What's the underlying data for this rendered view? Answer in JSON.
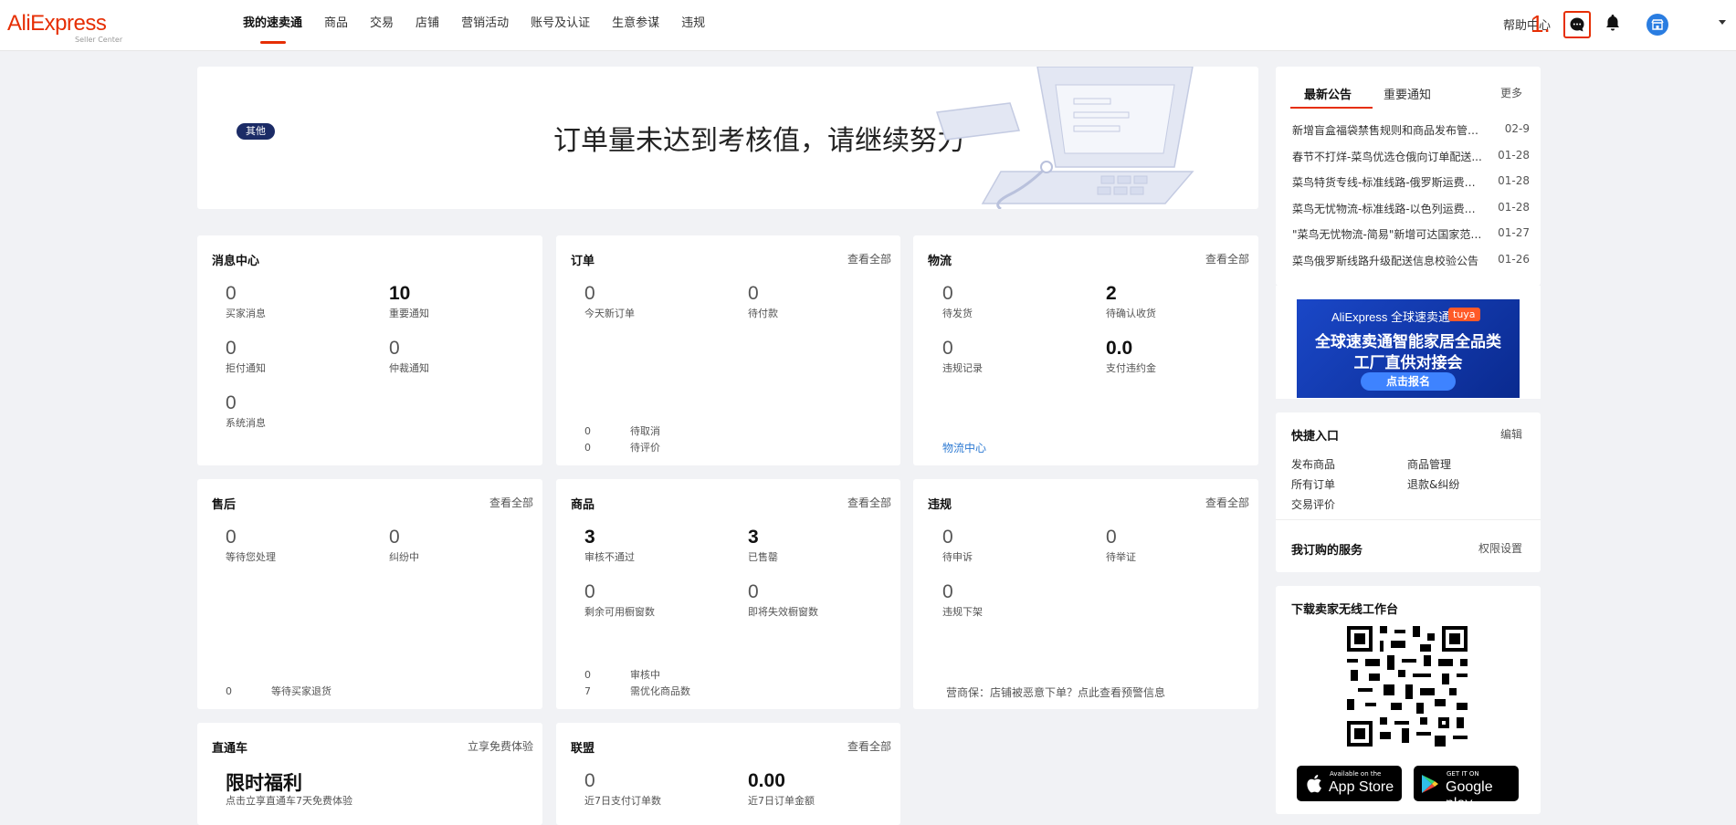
{
  "header": {
    "logo_text": "AliExpress",
    "logo_sub": "Seller Center",
    "nav": [
      "我的速卖通",
      "商品",
      "交易",
      "店铺",
      "营销活动",
      "账号及认证",
      "生意参谋",
      "违规"
    ],
    "help": "帮助中心",
    "annotation": "1."
  },
  "banner": {
    "badge": "其他",
    "title": "订单量未达到考核值，请继续努力"
  },
  "messages": {
    "title": "消息中心",
    "stats": [
      {
        "num": "0",
        "label": "买家消息"
      },
      {
        "num": "10",
        "label": "重要通知"
      },
      {
        "num": "0",
        "label": "拒付通知"
      },
      {
        "num": "0",
        "label": "仲裁通知"
      },
      {
        "num": "0",
        "label": "系统消息"
      }
    ]
  },
  "orders": {
    "title": "订单",
    "link": "查看全部",
    "stats": [
      {
        "num": "0",
        "label": "今天新订单"
      },
      {
        "num": "0",
        "label": "待付款"
      }
    ],
    "small": [
      {
        "num": "0",
        "label": "待取消"
      },
      {
        "num": "0",
        "label": "待评价"
      }
    ]
  },
  "logistics": {
    "title": "物流",
    "link": "查看全部",
    "stats": [
      {
        "num": "0",
        "label": "待发货"
      },
      {
        "num": "2",
        "label": "待确认收货"
      },
      {
        "num": "0",
        "label": "违规记录"
      },
      {
        "num": "0.0",
        "label": "支付违约金"
      }
    ],
    "center_link": "物流中心"
  },
  "aftersale": {
    "title": "售后",
    "link": "查看全部",
    "stats": [
      {
        "num": "0",
        "label": "等待您处理"
      },
      {
        "num": "0",
        "label": "纠纷中"
      }
    ],
    "small": {
      "num": "0",
      "label": "等待买家退货"
    }
  },
  "products": {
    "title": "商品",
    "link": "查看全部",
    "stats": [
      {
        "num": "3",
        "label": "审核不通过"
      },
      {
        "num": "3",
        "label": "已售罄"
      },
      {
        "num": "0",
        "label": "剩余可用橱窗数"
      },
      {
        "num": "0",
        "label": "即将失效橱窗数"
      }
    ],
    "small": [
      {
        "num": "0",
        "label": "审核中"
      },
      {
        "num": "7",
        "label": "需优化商品数"
      }
    ]
  },
  "violations": {
    "title": "违规",
    "link": "查看全部",
    "stats": [
      {
        "num": "0",
        "label": "待申诉"
      },
      {
        "num": "0",
        "label": "待举证"
      },
      {
        "num": "0",
        "label": "违规下架"
      }
    ],
    "footer": "营商保：店铺被恶意下单？点此查看预警信息"
  },
  "directcar": {
    "title": "直通车",
    "link": "立享免费体验",
    "promo": "限时福利",
    "promo_sub": "点击立享直通车7天免费体验"
  },
  "alliance": {
    "title": "联盟",
    "link": "查看全部",
    "stats": [
      {
        "num": "0",
        "label": "近7日支付订单数"
      },
      {
        "num": "0.00",
        "label": "近7日订单金额"
      }
    ]
  },
  "announcements": {
    "tabs": [
      "最新公告",
      "重要通知"
    ],
    "more": "更多",
    "items": [
      {
        "title": "新增盲盒福袋禁售规则和商品发布管理...",
        "date": "02-9"
      },
      {
        "title": "春节不打烊-菜鸟优选仓俄向订单配送...",
        "date": "01-28"
      },
      {
        "title": "菜鸟特货专线-标准线路-俄罗斯运费调...",
        "date": "01-28"
      },
      {
        "title": "菜鸟无忧物流-标准线路-以色列运费调...",
        "date": "01-28"
      },
      {
        "title": "\"菜鸟无忧物流-简易\"新增可达国家范围...",
        "date": "01-27"
      },
      {
        "title": "菜鸟俄罗斯线路升级配送信息校验公告",
        "date": "01-26"
      }
    ]
  },
  "ad": {
    "line1": "AliExpress 全球速卖通",
    "tag": "tuya",
    "line2": "全球速卖通智能家居全品类",
    "line3": "工厂直供对接会",
    "cta": "点击报名"
  },
  "quick": {
    "title": "快捷入口",
    "edit": "编辑",
    "links": [
      "发布商品",
      "商品管理",
      "所有订单",
      "退款&纠纷",
      "交易评价"
    ],
    "services_title": "我订购的服务",
    "services_link": "权限设置"
  },
  "download": {
    "title": "下载卖家无线工作台",
    "appstore_small": "Available on the",
    "appstore": "App Store",
    "gplay_small": "GET IT ON",
    "gplay": "Google play"
  },
  "colors": {
    "accent": "#e62e04",
    "badge": "#1b2b66",
    "link": "#2f7bd3",
    "background": "#f1f2f5"
  }
}
